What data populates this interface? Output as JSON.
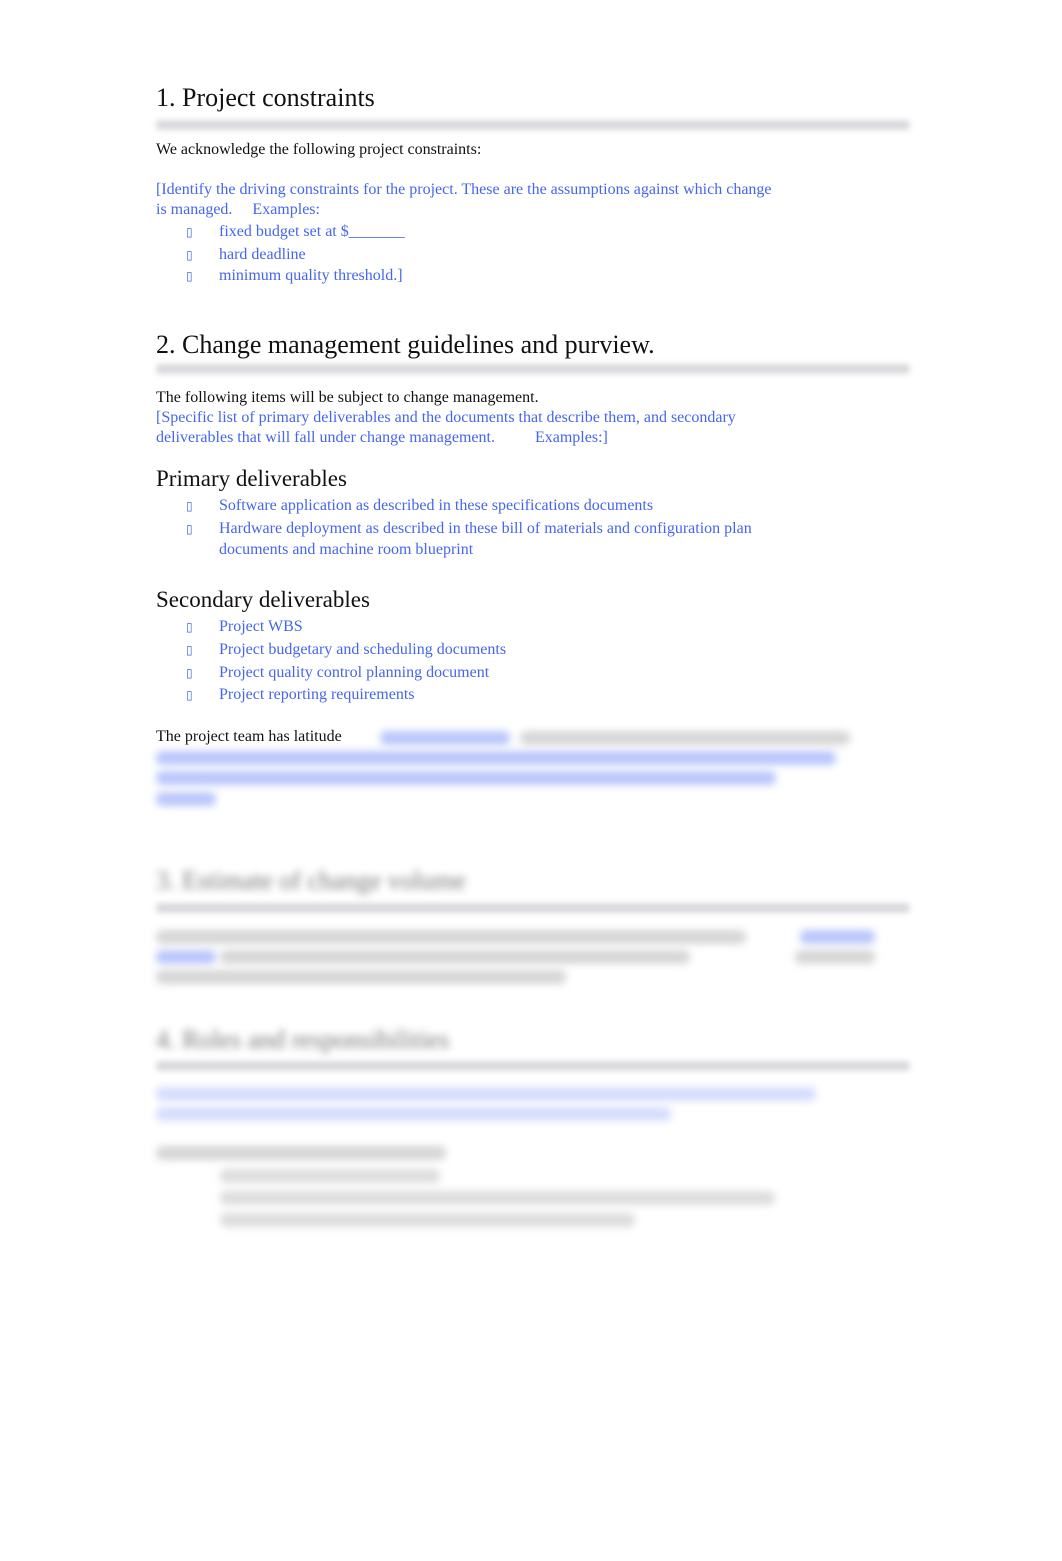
{
  "section1": {
    "heading": "1. Project constraints",
    "intro": "We acknowledge the following project constraints:",
    "guidance_line1": "[Identify the driving constraints for the project. These are the assumptions against which change",
    "guidance_line2": "is managed.     Examples:",
    "bullets": [
      "fixed budget set at $_______",
      "hard deadline",
      "minimum quality threshold.]"
    ]
  },
  "section2": {
    "heading": "2. Change management guidelines and purview.",
    "intro": "The following items will be subject to change management.",
    "guidance_line1": "[Specific list of primary deliverables and the documents that describe them, and secondary",
    "guidance_line2": "deliverables that will fall under change management.          Examples:]",
    "primary": {
      "heading": "Primary deliverables",
      "bullets": [
        "Software application as described in these specifications documents",
        "Hardware deployment as described in these bill of materials and configuration plan",
        "documents and machine room blueprint"
      ]
    },
    "secondary": {
      "heading": "Secondary deliverables",
      "bullets": [
        "Project WBS",
        "Project budgetary and scheduling documents",
        "Project quality control planning document",
        "Project reporting requirements"
      ]
    },
    "latitude": "The project team has latitude"
  },
  "blurred": {
    "section3_heading": "3. Estimate of change volume",
    "section4_heading": "4. Roles and responsibilities"
  },
  "bullet_glyph": "▯",
  "colors": {
    "guidance_text": "#4466ee",
    "body_text": "#111111"
  }
}
